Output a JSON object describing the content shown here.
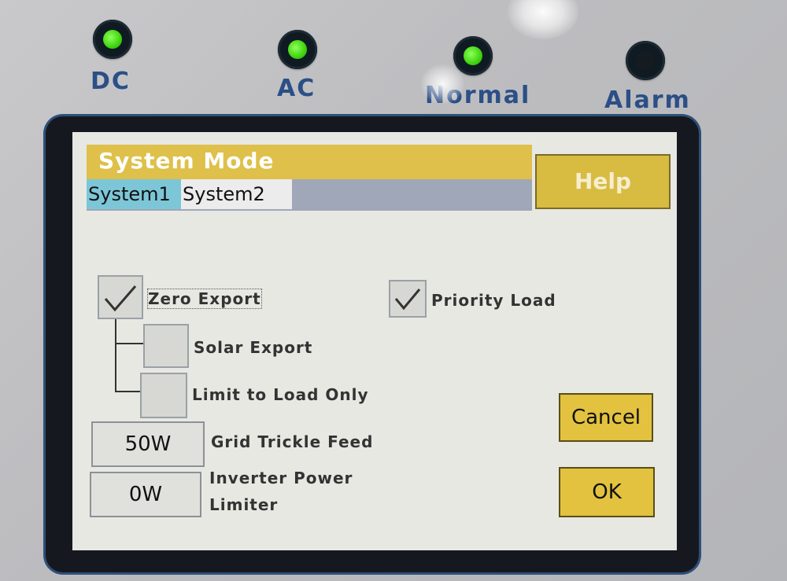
{
  "indicators": [
    {
      "label": "DC",
      "state": "on"
    },
    {
      "label": "AC",
      "state": "on"
    },
    {
      "label": "Normal",
      "state": "on"
    },
    {
      "label": "Alarm",
      "state": "off"
    }
  ],
  "screen": {
    "title": "System Mode",
    "tabs": [
      {
        "label": "System1",
        "active": true
      },
      {
        "label": "System2",
        "active": false
      }
    ],
    "help_label": "Help",
    "options": {
      "zero_export": {
        "label": "Zero Export",
        "checked": true
      },
      "solar_export": {
        "label": "Solar Export",
        "checked": false
      },
      "limit_to_load_only": {
        "label": "Limit to Load Only",
        "checked": false
      },
      "priority_load": {
        "label": "Priority Load",
        "checked": true
      }
    },
    "grid_trickle_feed": {
      "value": "50W",
      "label": "Grid Trickle Feed"
    },
    "inverter_power_limiter": {
      "value": "0W",
      "label_line1": "Inverter Power",
      "label_line2": "Limiter"
    },
    "cancel_label": "Cancel",
    "ok_label": "OK"
  },
  "colors": {
    "title_bar": "#dec04a",
    "active_tab": "#7dc6d8",
    "button": "#e2c23f",
    "led_on": "#3fd40f",
    "label_blue": "#2b4f86"
  }
}
